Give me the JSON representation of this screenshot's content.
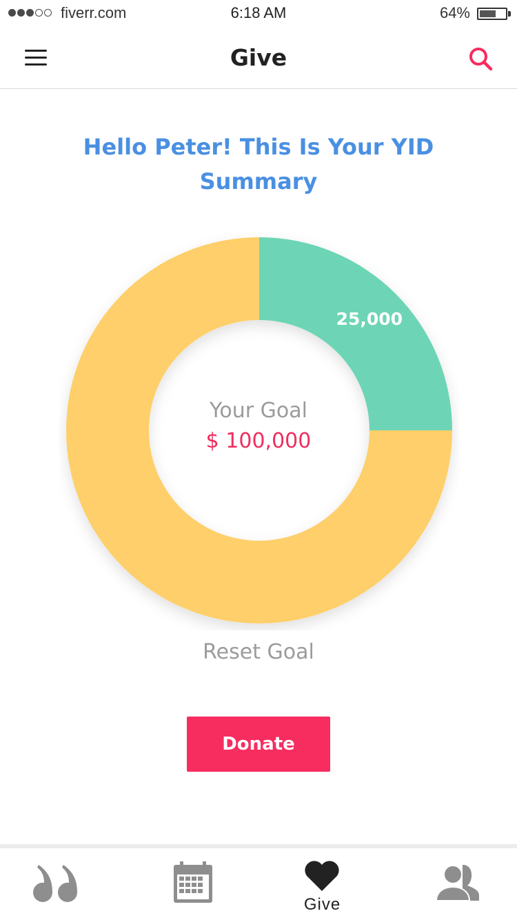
{
  "status_bar": {
    "carrier": "fiverr.com",
    "time": "6:18 AM",
    "battery_percent": "64%",
    "battery_level": 0.64,
    "signal_bars_filled": 3,
    "signal_bars_total": 5
  },
  "nav": {
    "title": "Give",
    "menu_icon": "hamburger-menu-icon",
    "search_icon": "search-icon"
  },
  "heading": "Hello Peter! This Is Your YID Summary",
  "chart_data": {
    "type": "pie",
    "style": "donut",
    "total": 100000,
    "slices": [
      {
        "label": "25,000",
        "value": 25000,
        "color": "#6dd5b5"
      },
      {
        "label": "",
        "value": 75000,
        "color": "#fecf6a"
      }
    ],
    "center_label": "Your Goal",
    "center_value": "$ 100,000"
  },
  "reset_goal_label": "Reset Goal",
  "donate_label": "Donate",
  "tabs": [
    {
      "name": "quotes",
      "icon": "quote-icon",
      "label": ""
    },
    {
      "name": "calendar",
      "icon": "calendar-icon",
      "label": ""
    },
    {
      "name": "give",
      "icon": "heart-icon",
      "label": "Give",
      "active": true
    },
    {
      "name": "people",
      "icon": "people-icon",
      "label": ""
    }
  ],
  "colors": {
    "accent": "#f72c5f",
    "heading": "#4a90e2",
    "teal": "#6dd5b5",
    "yellow": "#fecf6a",
    "muted": "#9b9b9b"
  }
}
